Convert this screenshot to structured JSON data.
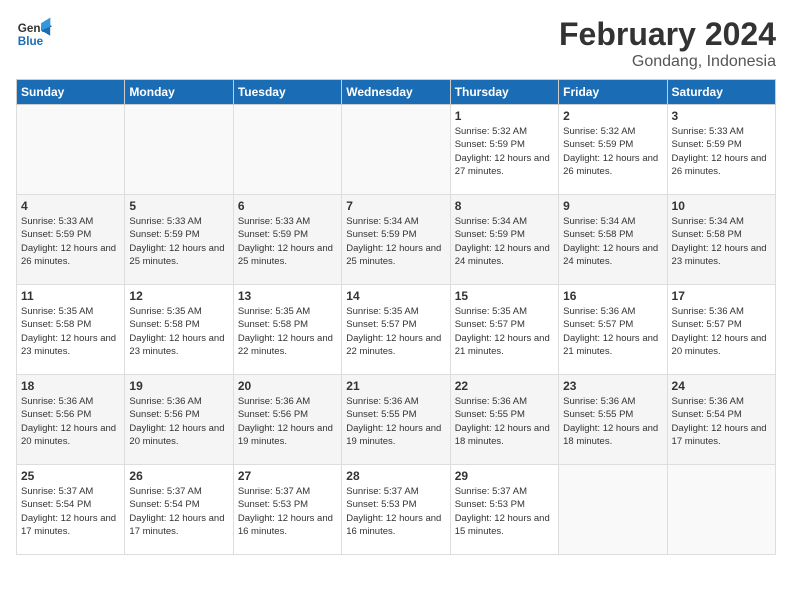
{
  "header": {
    "logo_line1": "General",
    "logo_line2": "Blue",
    "month_title": "February 2024",
    "location": "Gondang, Indonesia"
  },
  "weekdays": [
    "Sunday",
    "Monday",
    "Tuesday",
    "Wednesday",
    "Thursday",
    "Friday",
    "Saturday"
  ],
  "weeks": [
    [
      {
        "day": "",
        "info": ""
      },
      {
        "day": "",
        "info": ""
      },
      {
        "day": "",
        "info": ""
      },
      {
        "day": "",
        "info": ""
      },
      {
        "day": "1",
        "info": "Sunrise: 5:32 AM\nSunset: 5:59 PM\nDaylight: 12 hours\nand 27 minutes."
      },
      {
        "day": "2",
        "info": "Sunrise: 5:32 AM\nSunset: 5:59 PM\nDaylight: 12 hours\nand 26 minutes."
      },
      {
        "day": "3",
        "info": "Sunrise: 5:33 AM\nSunset: 5:59 PM\nDaylight: 12 hours\nand 26 minutes."
      }
    ],
    [
      {
        "day": "4",
        "info": "Sunrise: 5:33 AM\nSunset: 5:59 PM\nDaylight: 12 hours\nand 26 minutes."
      },
      {
        "day": "5",
        "info": "Sunrise: 5:33 AM\nSunset: 5:59 PM\nDaylight: 12 hours\nand 25 minutes."
      },
      {
        "day": "6",
        "info": "Sunrise: 5:33 AM\nSunset: 5:59 PM\nDaylight: 12 hours\nand 25 minutes."
      },
      {
        "day": "7",
        "info": "Sunrise: 5:34 AM\nSunset: 5:59 PM\nDaylight: 12 hours\nand 25 minutes."
      },
      {
        "day": "8",
        "info": "Sunrise: 5:34 AM\nSunset: 5:59 PM\nDaylight: 12 hours\nand 24 minutes."
      },
      {
        "day": "9",
        "info": "Sunrise: 5:34 AM\nSunset: 5:58 PM\nDaylight: 12 hours\nand 24 minutes."
      },
      {
        "day": "10",
        "info": "Sunrise: 5:34 AM\nSunset: 5:58 PM\nDaylight: 12 hours\nand 23 minutes."
      }
    ],
    [
      {
        "day": "11",
        "info": "Sunrise: 5:35 AM\nSunset: 5:58 PM\nDaylight: 12 hours\nand 23 minutes."
      },
      {
        "day": "12",
        "info": "Sunrise: 5:35 AM\nSunset: 5:58 PM\nDaylight: 12 hours\nand 23 minutes."
      },
      {
        "day": "13",
        "info": "Sunrise: 5:35 AM\nSunset: 5:58 PM\nDaylight: 12 hours\nand 22 minutes."
      },
      {
        "day": "14",
        "info": "Sunrise: 5:35 AM\nSunset: 5:57 PM\nDaylight: 12 hours\nand 22 minutes."
      },
      {
        "day": "15",
        "info": "Sunrise: 5:35 AM\nSunset: 5:57 PM\nDaylight: 12 hours\nand 21 minutes."
      },
      {
        "day": "16",
        "info": "Sunrise: 5:36 AM\nSunset: 5:57 PM\nDaylight: 12 hours\nand 21 minutes."
      },
      {
        "day": "17",
        "info": "Sunrise: 5:36 AM\nSunset: 5:57 PM\nDaylight: 12 hours\nand 20 minutes."
      }
    ],
    [
      {
        "day": "18",
        "info": "Sunrise: 5:36 AM\nSunset: 5:56 PM\nDaylight: 12 hours\nand 20 minutes."
      },
      {
        "day": "19",
        "info": "Sunrise: 5:36 AM\nSunset: 5:56 PM\nDaylight: 12 hours\nand 20 minutes."
      },
      {
        "day": "20",
        "info": "Sunrise: 5:36 AM\nSunset: 5:56 PM\nDaylight: 12 hours\nand 19 minutes."
      },
      {
        "day": "21",
        "info": "Sunrise: 5:36 AM\nSunset: 5:55 PM\nDaylight: 12 hours\nand 19 minutes."
      },
      {
        "day": "22",
        "info": "Sunrise: 5:36 AM\nSunset: 5:55 PM\nDaylight: 12 hours\nand 18 minutes."
      },
      {
        "day": "23",
        "info": "Sunrise: 5:36 AM\nSunset: 5:55 PM\nDaylight: 12 hours\nand 18 minutes."
      },
      {
        "day": "24",
        "info": "Sunrise: 5:36 AM\nSunset: 5:54 PM\nDaylight: 12 hours\nand 17 minutes."
      }
    ],
    [
      {
        "day": "25",
        "info": "Sunrise: 5:37 AM\nSunset: 5:54 PM\nDaylight: 12 hours\nand 17 minutes."
      },
      {
        "day": "26",
        "info": "Sunrise: 5:37 AM\nSunset: 5:54 PM\nDaylight: 12 hours\nand 17 minutes."
      },
      {
        "day": "27",
        "info": "Sunrise: 5:37 AM\nSunset: 5:53 PM\nDaylight: 12 hours\nand 16 minutes."
      },
      {
        "day": "28",
        "info": "Sunrise: 5:37 AM\nSunset: 5:53 PM\nDaylight: 12 hours\nand 16 minutes."
      },
      {
        "day": "29",
        "info": "Sunrise: 5:37 AM\nSunset: 5:53 PM\nDaylight: 12 hours\nand 15 minutes."
      },
      {
        "day": "",
        "info": ""
      },
      {
        "day": "",
        "info": ""
      }
    ]
  ]
}
